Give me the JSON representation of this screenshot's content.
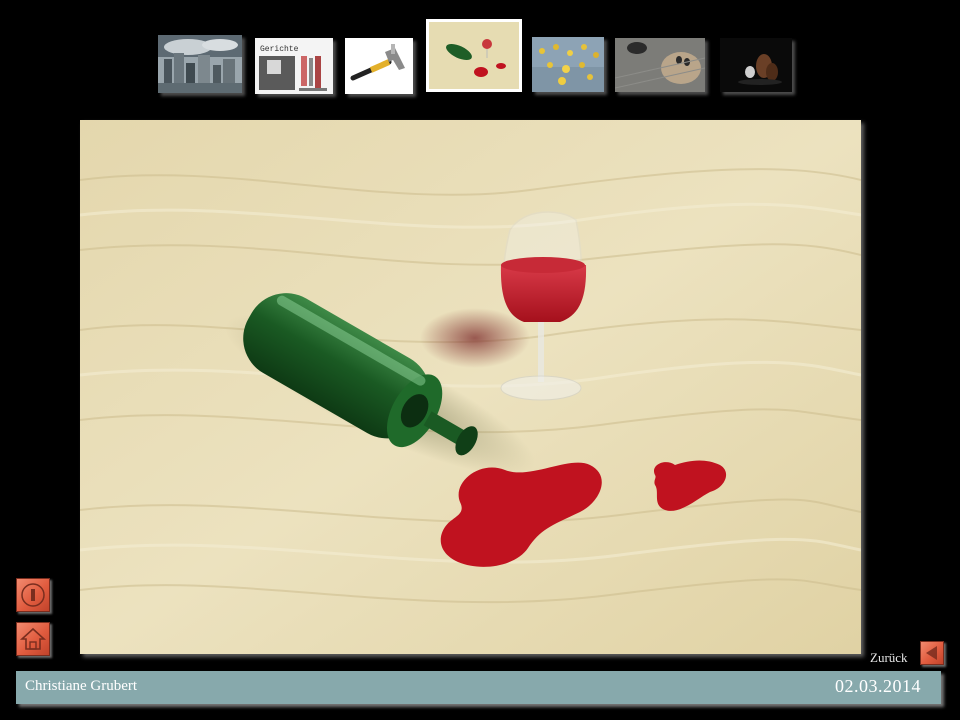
{
  "thumbnails": [
    {
      "id": "city",
      "icon": "city-skyline-thumbnail"
    },
    {
      "id": "gerichte",
      "icon": "menu-card-thumbnail",
      "caption": "Gerichte"
    },
    {
      "id": "hammer",
      "icon": "hammer-thumbnail"
    },
    {
      "id": "wine",
      "icon": "wine-bottle-thumbnail",
      "active": true
    },
    {
      "id": "flowers",
      "icon": "flowers-thumbnail"
    },
    {
      "id": "table",
      "icon": "round-table-thumbnail"
    },
    {
      "id": "figures",
      "icon": "figurines-thumbnail"
    }
  ],
  "navigation": {
    "info_icon": "info-icon",
    "home_icon": "home-icon",
    "back_label": "Zurück",
    "back_icon": "back-arrow-icon"
  },
  "footer": {
    "author": "Christiane Grubert",
    "date": "02.03.2014"
  },
  "colors": {
    "background": "#000000",
    "footer_bar": "#87a9ac",
    "button": "#e15c3f",
    "wine": "#b3121f",
    "bottle": "#1f6a2a",
    "table_wood": "#e8dcb4"
  }
}
